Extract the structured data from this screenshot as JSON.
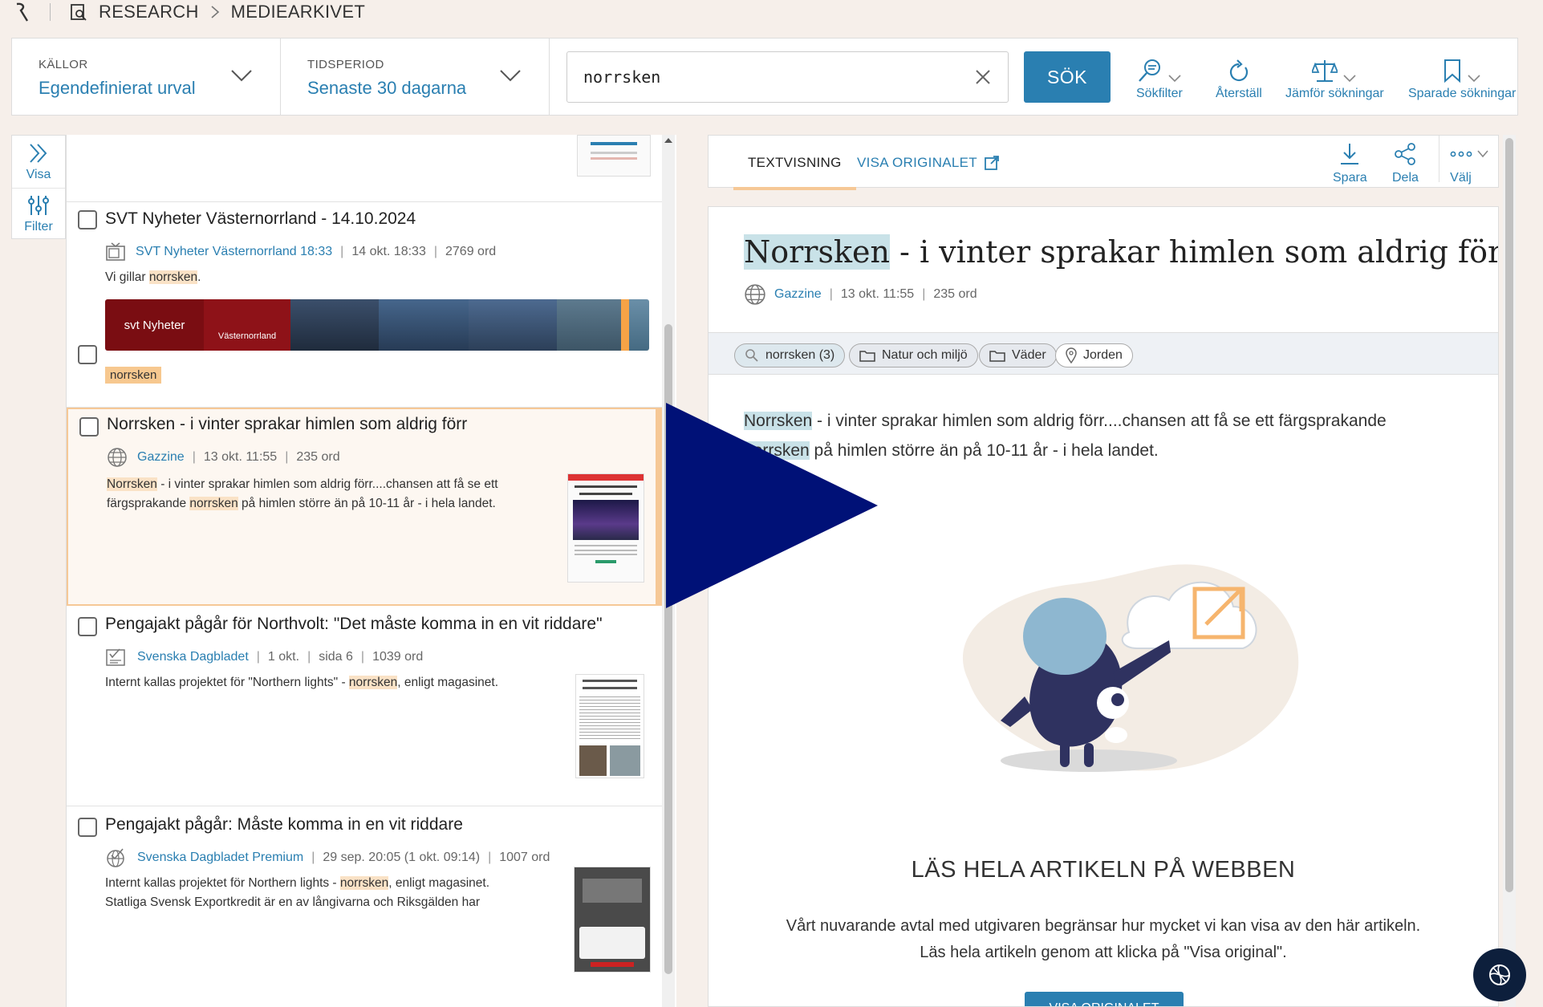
{
  "breadcrumb": {
    "section": "RESEARCH",
    "page": "MEDIEARKIVET"
  },
  "search": {
    "sources_label": "KÄLLOR",
    "sources_value": "Egendefinierat urval",
    "period_label": "TIDSPERIOD",
    "period_value": "Senaste 30 dagarna",
    "query": "norrsken",
    "submit_label": "SÖK"
  },
  "toolbar": {
    "filter": "Sökfilter",
    "reset": "Återställ",
    "compare": "Jämför sökningar",
    "saved": "Sparade sökningar"
  },
  "side_strip": {
    "show": "Visa",
    "filter": "Filter"
  },
  "results": [
    {
      "title": "SVT Nyheter Västernorrland - 14.10.2024",
      "source": "SVT Nyheter Västernorrland 18:33",
      "date": "14 okt. 18:33",
      "words": "2769 ord",
      "snippet_pre": "Vi gillar ",
      "snippet_hl": "norrsken",
      "snippet_post": ".",
      "tag": "norrsken",
      "filmstrip": {
        "logo": "svt Nyheter",
        "region": "Västernorrland"
      }
    },
    {
      "title": "Norrsken - i vinter sprakar himlen som aldrig förr",
      "source": "Gazzine",
      "date": "13 okt. 11:55",
      "words": "235 ord",
      "snippet_hl1": "Norrsken",
      "snippet_mid": " - i vinter sprakar himlen som aldrig förr....chansen att få se ett färgsprakande ",
      "snippet_hl2": "norrsken",
      "snippet_post": " på himlen större än på 10-11 år - i hela landet."
    },
    {
      "title": "Pengajakt pågår för Northvolt: \"Det måste komma in en vit riddare\"",
      "source": "Svenska Dagbladet",
      "date": "1 okt.",
      "page": "sida 6",
      "words": "1039 ord",
      "snippet_pre": "Internt kallas projektet för \"Northern lights\" - ",
      "snippet_hl": "norrsken",
      "snippet_post": ", enligt magasinet."
    },
    {
      "title": "Pengajakt pågår: Måste komma in en vit riddare",
      "source": "Svenska Dagbladet Premium",
      "date": "29 sep. 20:05 (1 okt. 09:14)",
      "words": "1007 ord",
      "snippet_pre": "Internt kallas projektet för Northern lights - ",
      "snippet_hl": "norrsken",
      "snippet_post": ", enligt magasinet.",
      "snippet_line2": "Statliga Svensk Exportkredit är en av långivarna och Riksgälden har"
    }
  ],
  "reader": {
    "tab_text": "TEXTVISNING",
    "tab_original": "VISA ORIGINALET",
    "actions": {
      "save": "Spara",
      "share": "Dela",
      "choose": "Välj"
    },
    "title_hl": "Norrsken",
    "title_rest": " - i vinter sprakar himlen som aldrig förr",
    "source": "Gazzine",
    "date": "13 okt. 11:55",
    "words": "235 ord",
    "tags": [
      "norrsken (3)",
      "Natur och miljö",
      "Väder",
      "Jorden"
    ],
    "body_hl1": "Norrsken",
    "body_mid": " - i vinter sprakar himlen som aldrig förr....chansen att få se ett färgsprakande",
    "body_hl2": "norrsken",
    "body_post": " på himlen större än på 10-11 år - i hela landet.",
    "read_heading": "LÄS HELA ARTIKELN PÅ WEBBEN",
    "read_line1": "Vårt nuvarande avtal med utgivaren begränsar hur mycket vi kan visa av den här artikeln.",
    "read_line2": "Läs hela artikeln genom att klicka på \"Visa original\".",
    "button": "VISA ORIGINALET"
  },
  "colors": {
    "accent": "#2a7fb1",
    "highlight": "#fae2c6",
    "tag_orange": "#f7c88f",
    "selected_border": "#f6c896",
    "reader_highlight": "#c9e2e8"
  }
}
